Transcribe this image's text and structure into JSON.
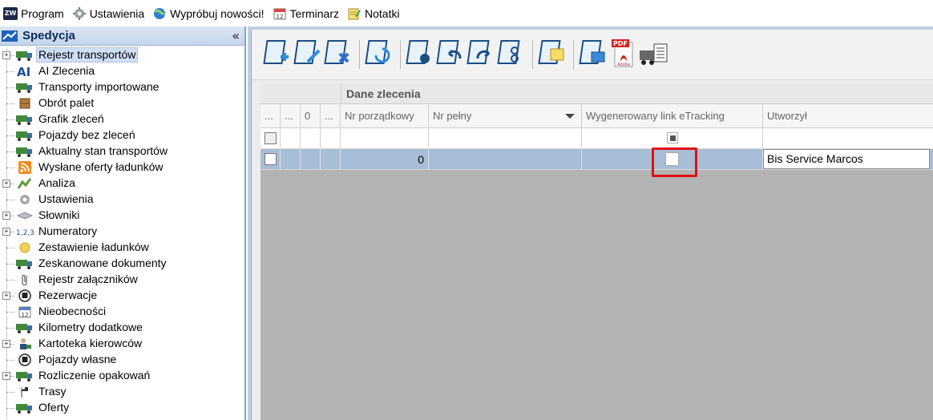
{
  "menubar": {
    "items": [
      {
        "label": "Program",
        "icon": "app-logo-icon"
      },
      {
        "label": "Ustawienia",
        "icon": "gear-icon"
      },
      {
        "label": "Wypróbuj nowości!",
        "icon": "globe-icon"
      },
      {
        "label": "Terminarz",
        "icon": "calendar-icon"
      },
      {
        "label": "Notatki",
        "icon": "notes-icon"
      }
    ],
    "logo_text": "ZW"
  },
  "sidebar": {
    "title": "Spedycja",
    "collapse_glyph": "«",
    "items": [
      {
        "label": "Rejestr transportów",
        "icon": "truck-icon",
        "expandable": true,
        "selected": true
      },
      {
        "label": "AI Zlecenia",
        "icon": "ai-icon",
        "expandable": false
      },
      {
        "label": "Transporty importowane",
        "icon": "truck-icon",
        "expandable": false
      },
      {
        "label": "Obrót palet",
        "icon": "pallet-box-icon",
        "expandable": false
      },
      {
        "label": "Grafik zleceń",
        "icon": "truck-icon",
        "expandable": false
      },
      {
        "label": "Pojazdy bez zleceń",
        "icon": "truck-icon",
        "expandable": false
      },
      {
        "label": "Aktualny stan transportów",
        "icon": "truck-icon",
        "expandable": false
      },
      {
        "label": "Wysłane oferty ładunków",
        "icon": "rss-icon",
        "expandable": false
      },
      {
        "label": "Analiza",
        "icon": "analysis-icon",
        "expandable": true
      },
      {
        "label": "Ustawienia",
        "icon": "gear-icon",
        "expandable": false
      },
      {
        "label": "Słowniki",
        "icon": "dictionary-icon",
        "expandable": true
      },
      {
        "label": "Numeratory",
        "icon": "numbering-icon",
        "expandable": true
      },
      {
        "label": "Zestawienie ładunków",
        "icon": "cargo-icon",
        "expandable": false
      },
      {
        "label": "Zeskanowane dokumenty",
        "icon": "truck-icon",
        "expandable": false
      },
      {
        "label": "Rejestr załączników",
        "icon": "paperclip-icon",
        "expandable": false
      },
      {
        "label": "Rezerwacje",
        "icon": "bus-icon",
        "expandable": true
      },
      {
        "label": "Nieobecności",
        "icon": "calendar-icon",
        "expandable": false
      },
      {
        "label": "Kilometry dodatkowe",
        "icon": "truck-icon",
        "expandable": false
      },
      {
        "label": "Kartoteka kierowców",
        "icon": "driver-icon",
        "expandable": true
      },
      {
        "label": "Pojazdy własne",
        "icon": "bus-icon",
        "expandable": false
      },
      {
        "label": "Rozliczenie opakowań",
        "icon": "truck-icon",
        "expandable": true
      },
      {
        "label": "Trasy",
        "icon": "route-flag-icon",
        "expandable": false
      },
      {
        "label": "Oferty",
        "icon": "truck-icon",
        "expandable": false
      }
    ]
  },
  "toolbar": {
    "buttons": [
      "add-document-icon",
      "edit-document-icon",
      "delete-document-icon",
      "refresh-document-icon",
      "view-document-icon",
      "undo-document-icon",
      "redo-document-icon",
      "info-document-icon",
      "folder-document-icon",
      "export-document-icon",
      "pdf-icon",
      "print-truck-icon"
    ],
    "pdf_text": "PDF",
    "pdf_sub": "Adobe"
  },
  "grid": {
    "group_caption": "Dane zlecenia",
    "columns": [
      {
        "label": "..."
      },
      {
        "label": "..."
      },
      {
        "label": "0"
      },
      {
        "label": "..."
      },
      {
        "label": "Nr porządkowy"
      },
      {
        "label": "Nr pełny"
      },
      {
        "label": "Wygenerowany link eTracking"
      },
      {
        "label": "Utworzył"
      }
    ],
    "rows": [
      {
        "nr_porzadkowy": "0",
        "nr_pelny": "",
        "etracking": false,
        "utworzyl": "Bis Service Marcos"
      }
    ]
  },
  "colors": {
    "selected_row": "#a8bdd6",
    "highlight": "#e01010",
    "pane_border": "#bfcfe2"
  }
}
